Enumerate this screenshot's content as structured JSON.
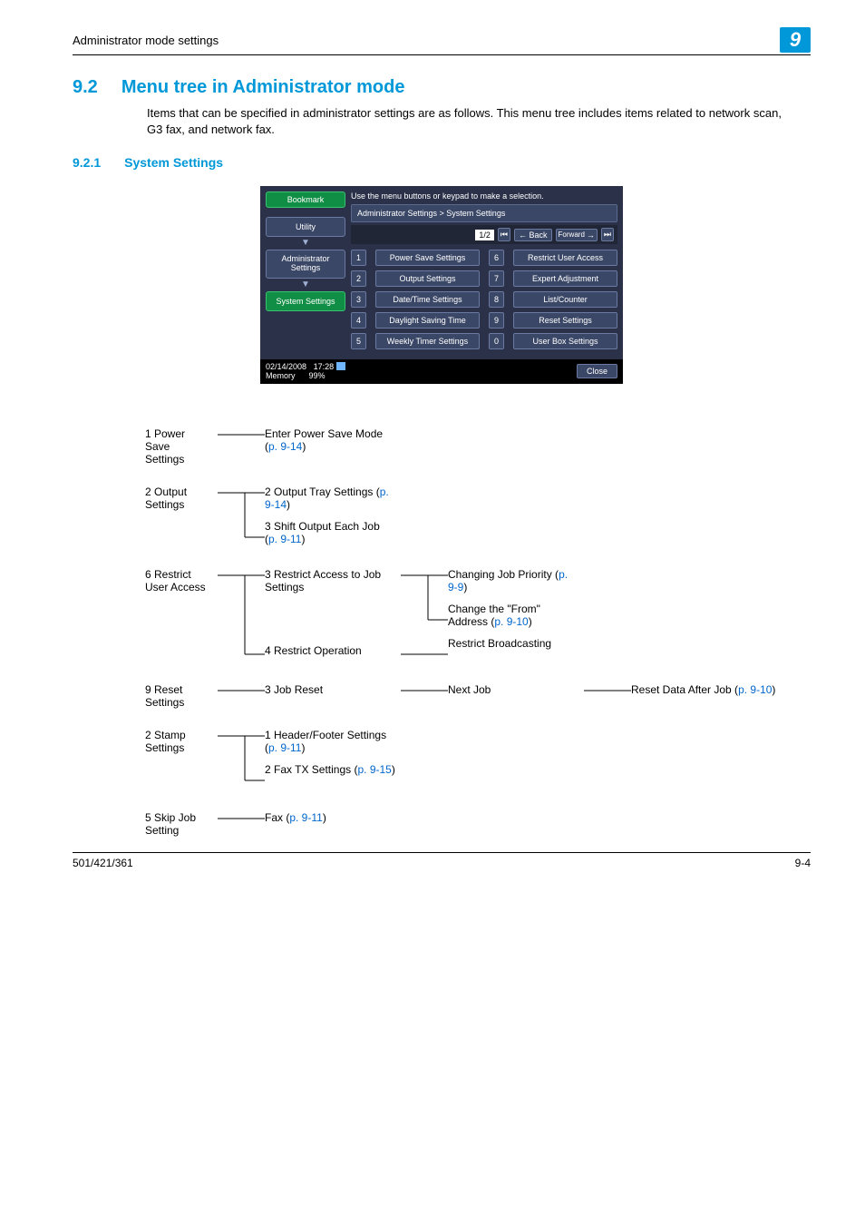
{
  "header": {
    "left": "Administrator mode settings",
    "chapter_badge": "9"
  },
  "section": {
    "number": "9.2",
    "title": "Menu tree in Administrator mode",
    "body": "Items that can be specified in administrator settings are as follows. This menu tree includes items related to network scan, G3 fax, and network fax."
  },
  "subsection": {
    "number": "9.2.1",
    "title": "System Settings"
  },
  "screenshot": {
    "instruction": "Use the menu buttons or keypad to make a selection.",
    "breadcrumb": "Administrator Settings > System Settings",
    "page_indicator": "1/2",
    "back_label": "Back",
    "forward_label": "Forward",
    "bookmark": "Bookmark",
    "side": {
      "utility": "Utility",
      "admin": "Administrator Settings",
      "system": "System Settings"
    },
    "menu": {
      "left": [
        {
          "n": "1",
          "label": "Power Save Settings"
        },
        {
          "n": "2",
          "label": "Output Settings"
        },
        {
          "n": "3",
          "label": "Date/Time Settings"
        },
        {
          "n": "4",
          "label": "Daylight Saving Time"
        },
        {
          "n": "5",
          "label": "Weekly Timer Settings"
        }
      ],
      "right": [
        {
          "n": "6",
          "label": "Restrict User Access"
        },
        {
          "n": "7",
          "label": "Expert Adjustment"
        },
        {
          "n": "8",
          "label": "List/Counter"
        },
        {
          "n": "9",
          "label": "Reset Settings"
        },
        {
          "n": "0",
          "label": "User Box Settings"
        }
      ]
    },
    "status": {
      "date": "02/14/2008",
      "time": "17:28",
      "memory_label": "Memory",
      "memory_pct": "99%"
    },
    "close": "Close"
  },
  "tree": {
    "r1_c1": "1 Power Save Settings",
    "r1_c2a": "Enter Power Save Mode (",
    "r1_c2b": "p. 9-14",
    "r2_c1": "2 Output Settings",
    "r2_c2a": "2 Output Tray Settings (",
    "r2_c2b": "p. 9-14",
    "r2_c2c": "3 Shift Output Each Job (",
    "r2_c2d": "p. 9-11",
    "r3_c1": "6 Restrict User Access",
    "r3_c2a": "3 Restrict Access to Job Settings",
    "r3_c3a": "Changing Job Priority (",
    "r3_c3b": "p. 9-9",
    "r3_c3c": "Change the \"From\" Address (",
    "r3_c3d": "p. 9-10",
    "r3_c2b": "4 Restrict Operation",
    "r3_c3e": "Restrict Broadcasting",
    "r4_c1": "9 Reset Settings",
    "r4_c2": "3 Job Reset",
    "r4_c3": "Next Job",
    "r4_c4a": "Reset Data After Job (",
    "r4_c4b": "p. 9-10",
    "r5_c1": "2 Stamp Settings",
    "r5_c2a": "1 Header/Footer Settings (",
    "r5_c2b": "p. 9-11",
    "r5_c2c": "2 Fax TX Settings (",
    "r5_c2d": "p. 9-15",
    "r6_c1": "5 Skip Job Setting",
    "r6_c2a": "Fax (",
    "r6_c2b": "p. 9-11"
  },
  "footer": {
    "left": "501/421/361",
    "right": "9-4"
  }
}
